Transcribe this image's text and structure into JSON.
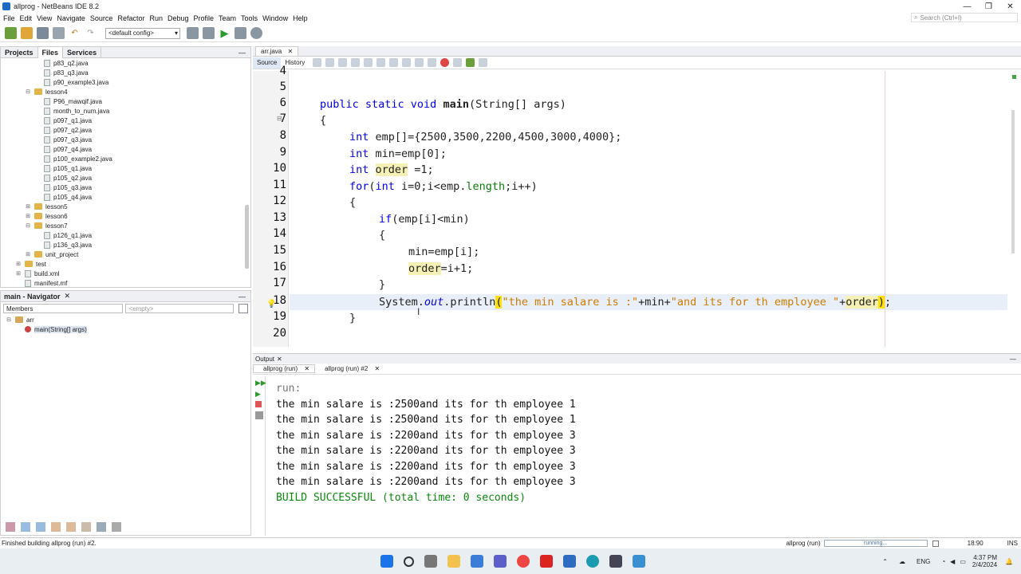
{
  "window": {
    "title": "allprog - NetBeans IDE 8.2",
    "controls": [
      "—",
      "❐",
      "✕"
    ]
  },
  "menu": [
    "File",
    "Edit",
    "View",
    "Navigate",
    "Source",
    "Refactor",
    "Run",
    "Debug",
    "Profile",
    "Team",
    "Tools",
    "Window",
    "Help"
  ],
  "search": {
    "placeholder": "Search (Ctrl+I)"
  },
  "toolbar": {
    "config": "<default config>"
  },
  "project_tabs": [
    "Projects",
    "Files",
    "Services"
  ],
  "tree": [
    {
      "label": "p83_q2.java",
      "depth": 3,
      "type": "file"
    },
    {
      "label": "p83_q3.java",
      "depth": 3,
      "type": "file"
    },
    {
      "label": "p90_example3.java",
      "depth": 3,
      "type": "file"
    },
    {
      "label": "lesson4",
      "depth": 2,
      "type": "dir",
      "open": true
    },
    {
      "label": "P96_mawqif.java",
      "depth": 3,
      "type": "file"
    },
    {
      "label": "month_to_num.java",
      "depth": 3,
      "type": "file"
    },
    {
      "label": "p097_q1.java",
      "depth": 3,
      "type": "file"
    },
    {
      "label": "p097_q2.java",
      "depth": 3,
      "type": "file"
    },
    {
      "label": "p097_q3.java",
      "depth": 3,
      "type": "file"
    },
    {
      "label": "p097_q4.java",
      "depth": 3,
      "type": "file"
    },
    {
      "label": "p100_example2.java",
      "depth": 3,
      "type": "file"
    },
    {
      "label": "p105_q1.java",
      "depth": 3,
      "type": "file"
    },
    {
      "label": "p105_q2.java",
      "depth": 3,
      "type": "file"
    },
    {
      "label": "p105_q3.java",
      "depth": 3,
      "type": "file"
    },
    {
      "label": "p105_q4.java",
      "depth": 3,
      "type": "file"
    },
    {
      "label": "lesson5",
      "depth": 2,
      "type": "dir",
      "open": false
    },
    {
      "label": "lesson6",
      "depth": 2,
      "type": "dir",
      "open": false
    },
    {
      "label": "lesson7",
      "depth": 2,
      "type": "dir",
      "open": true
    },
    {
      "label": "p126_q1.java",
      "depth": 3,
      "type": "file"
    },
    {
      "label": "p136_q3.java",
      "depth": 3,
      "type": "file"
    },
    {
      "label": "unit_project",
      "depth": 2,
      "type": "dir",
      "open": false
    },
    {
      "label": "test",
      "depth": 1,
      "type": "dir",
      "open": false
    },
    {
      "label": "build.xml",
      "depth": 1,
      "type": "xml",
      "open": false
    },
    {
      "label": "manifest.mf",
      "depth": 1,
      "type": "file"
    }
  ],
  "navigator": {
    "title": "main - Navigator",
    "filter": "Members",
    "empty": "<empty>",
    "class": "arr",
    "method": "main(String[] args)"
  },
  "editor": {
    "tab": "arr.java",
    "source_tab": "Source",
    "history_tab": "History",
    "line_numbers": [
      "4",
      "5",
      "6",
      "7",
      "8",
      "9",
      "10",
      "11",
      "12",
      "13",
      "14",
      "15",
      "16",
      "17",
      "18",
      "19",
      "20"
    ]
  },
  "output": {
    "title": "Output",
    "tabs": [
      "allprog (run)",
      "allprog (run) #2"
    ],
    "lines": [
      "run:",
      "the min salare is :2500and its for th employee 1",
      "the min salare is :2500and its for th employee 1",
      "the min salare is :2200and its for th employee 3",
      "the min salare is :2200and its for th employee 3",
      "the min salare is :2200and its for th employee 3",
      "the min salare is :2200and its for th employee 3"
    ],
    "build": "BUILD SUCCESSFUL (total time: 0 seconds)"
  },
  "status": {
    "left": "Finished building allprog (run) #2.",
    "task": "allprog (run)",
    "progress": "running...",
    "pos": "18:90",
    "mode": "INS"
  },
  "tray": {
    "lang": "ENG",
    "time": "4:37 PM",
    "date": "2/4/2024"
  }
}
